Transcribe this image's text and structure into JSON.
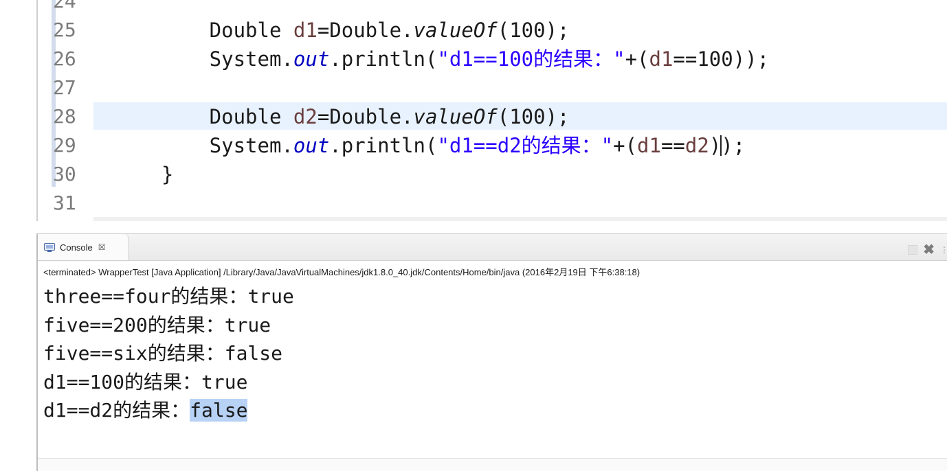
{
  "editor": {
    "lines": [
      {
        "num": "24",
        "tokens": []
      },
      {
        "num": "25",
        "tokens": [
          {
            "t": "        Double ",
            "c": "t-plain"
          },
          {
            "t": "d1",
            "c": "t-var"
          },
          {
            "t": "=Double.",
            "c": "t-plain"
          },
          {
            "t": "valueOf",
            "c": "t-method"
          },
          {
            "t": "(100);",
            "c": "t-plain"
          }
        ]
      },
      {
        "num": "26",
        "tokens": [
          {
            "t": "        System.",
            "c": "t-plain"
          },
          {
            "t": "out",
            "c": "t-field"
          },
          {
            "t": ".println(",
            "c": "t-plain"
          },
          {
            "t": "\"d1==100的结果：\"",
            "c": "t-str"
          },
          {
            "t": "+(",
            "c": "t-plain"
          },
          {
            "t": "d1",
            "c": "t-var"
          },
          {
            "t": "==100));",
            "c": "t-plain"
          }
        ]
      },
      {
        "num": "27",
        "tokens": []
      },
      {
        "num": "28",
        "tokens": [
          {
            "t": "        Double ",
            "c": "t-plain"
          },
          {
            "t": "d2",
            "c": "t-var"
          },
          {
            "t": "=Double.",
            "c": "t-plain"
          },
          {
            "t": "valueOf",
            "c": "t-method"
          },
          {
            "t": "(100);",
            "c": "t-plain"
          }
        ]
      },
      {
        "num": "29",
        "tokens": [
          {
            "t": "        System.",
            "c": "t-plain"
          },
          {
            "t": "out",
            "c": "t-field"
          },
          {
            "t": ".println(",
            "c": "t-plain"
          },
          {
            "t": "\"d1==d2的结果：\"",
            "c": "t-str"
          },
          {
            "t": "+(",
            "c": "t-plain"
          },
          {
            "t": "d1",
            "c": "t-var"
          },
          {
            "t": "==",
            "c": "t-plain"
          },
          {
            "t": "d2",
            "c": "t-var"
          },
          {
            "t": ")",
            "c": "t-plain"
          },
          {
            "t": "|caret|",
            "c": "caret"
          },
          {
            "t": ");",
            "c": "t-plain"
          }
        ]
      },
      {
        "num": "30",
        "tokens": [
          {
            "t": "    }",
            "c": "t-plain"
          }
        ]
      },
      {
        "num": "31",
        "tokens": []
      }
    ]
  },
  "console": {
    "tab_label": "Console",
    "close_symbol": "☒",
    "status": "<terminated> WrapperTest [Java Application] /Library/Java/JavaVirtualMachines/jdk1.8.0_40.jdk/Contents/Home/bin/java (2016年2月19日 下午6:38:18)",
    "output": [
      {
        "text": "three==four的结果：true",
        "prefix": "three==four的结果：",
        "value": "true",
        "selected": false
      },
      {
        "text": "five==200的结果：true",
        "prefix": "five==200的结果：",
        "value": "true",
        "selected": false
      },
      {
        "text": "five==six的结果：false",
        "prefix": "five==six的结果：",
        "value": "false",
        "selected": false
      },
      {
        "text": "d1==100的结果：true",
        "prefix": "d1==100的结果：",
        "value": "true",
        "selected": false
      },
      {
        "text": "d1==d2的结果：false",
        "prefix": "d1==d2的结果：",
        "value": "false",
        "selected": true
      }
    ]
  },
  "colors": {
    "string": "#2a00ff",
    "variable": "#6a3e3e",
    "field": "#0000c0",
    "selection": "#b7d2f5",
    "current_line": "#e8f2fe"
  }
}
